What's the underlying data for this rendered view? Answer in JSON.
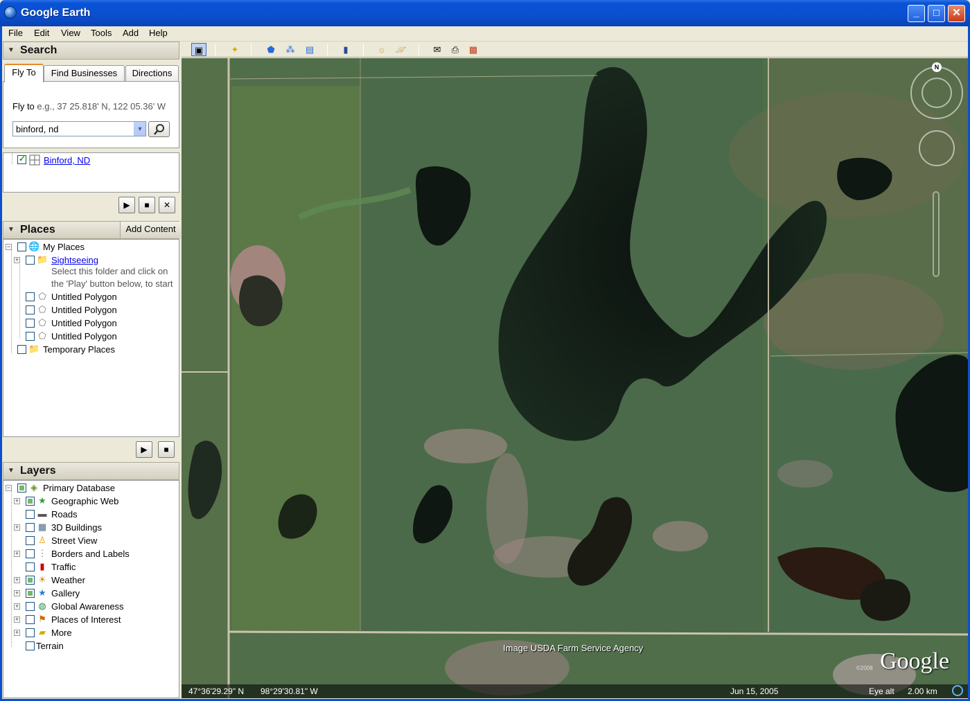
{
  "window": {
    "title": "Google Earth",
    "min_label": "_",
    "max_label": "□",
    "close_label": "✕"
  },
  "menu": [
    "File",
    "Edit",
    "View",
    "Tools",
    "Add",
    "Help"
  ],
  "search": {
    "header": "Search",
    "tabs": [
      "Fly To",
      "Find Businesses",
      "Directions"
    ],
    "hint_label": "Fly to",
    "hint_example": "e.g., 37 25.818' N, 122 05.36' W",
    "query": "binford, nd",
    "result": "Binford, ND"
  },
  "places": {
    "header": "Places",
    "add_content": "Add Content",
    "items": [
      {
        "label": "My Places"
      },
      {
        "label": "Sightseeing"
      },
      {
        "label": "Select this folder and click on"
      },
      {
        "label": "the 'Play' button below, to start"
      },
      {
        "label": "Untitled Polygon"
      },
      {
        "label": "Untitled Polygon"
      },
      {
        "label": "Untitled Polygon"
      },
      {
        "label": "Untitled Polygon"
      },
      {
        "label": "Temporary Places"
      }
    ]
  },
  "layers": {
    "header": "Layers",
    "items": [
      {
        "label": "Primary Database"
      },
      {
        "label": "Geographic Web"
      },
      {
        "label": "Roads"
      },
      {
        "label": "3D Buildings"
      },
      {
        "label": "Street View"
      },
      {
        "label": "Borders and Labels"
      },
      {
        "label": "Traffic"
      },
      {
        "label": "Weather"
      },
      {
        "label": "Gallery"
      },
      {
        "label": "Global Awareness"
      },
      {
        "label": "Places of Interest"
      },
      {
        "label": "More"
      },
      {
        "label": "Terrain"
      }
    ]
  },
  "map": {
    "attribution": "Image USDA Farm Service Agency",
    "logo": "Google",
    "copyright": "©2008",
    "compass_n": "N",
    "lat": "47°36'29.29\" N",
    "lon": "98°29'30.81\" W",
    "date": "Jun 15, 2005",
    "eye_alt_label": "Eye alt",
    "eye_alt_value": "2.00 km"
  },
  "colors": {
    "titlebar": "#0a4fcf",
    "chrome": "#ece9d8",
    "link": "#0000ee"
  }
}
